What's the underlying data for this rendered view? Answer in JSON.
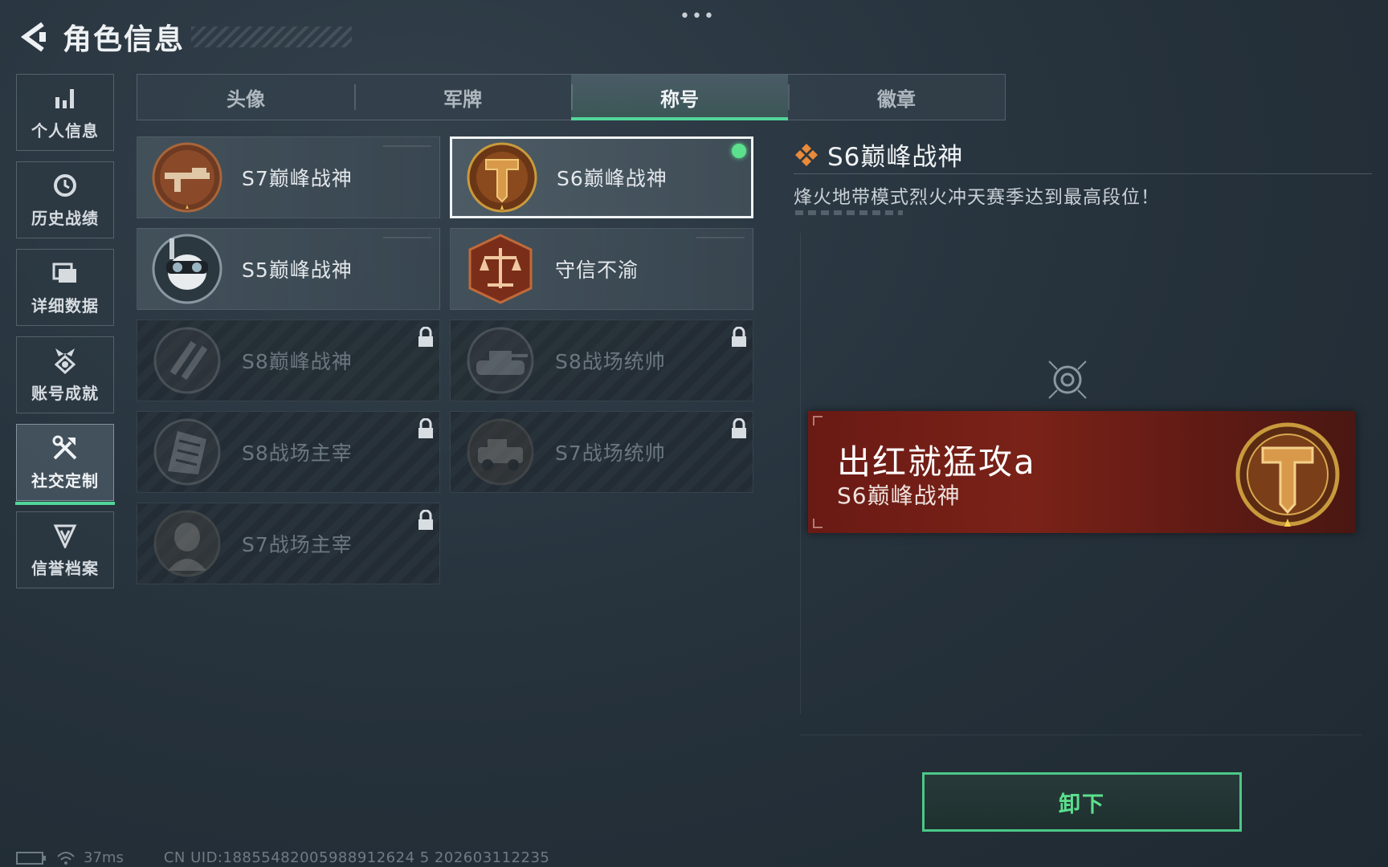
{
  "header": {
    "title": "角色信息",
    "back_icon": "back-arrow-icon",
    "more_icon": "more-dots-icon",
    "more_text": "•••"
  },
  "sidebar": {
    "items": [
      {
        "label": "个人信息",
        "icon": "bar-chart-icon",
        "active": false
      },
      {
        "label": "历史战绩",
        "icon": "clock-history-icon",
        "active": false
      },
      {
        "label": "详细数据",
        "icon": "folder-icon",
        "active": false
      },
      {
        "label": "账号成就",
        "icon": "medal-icon",
        "active": false
      },
      {
        "label": "社交定制",
        "icon": "tools-icon",
        "active": true
      },
      {
        "label": "信誉档案",
        "icon": "shield-badge-icon",
        "active": false
      }
    ]
  },
  "tabs": [
    {
      "label": "头像",
      "active": false
    },
    {
      "label": "军牌",
      "active": false
    },
    {
      "label": "称号",
      "active": true
    },
    {
      "label": "徽章",
      "active": false
    }
  ],
  "titles": [
    {
      "label": "S7巅峰战神",
      "locked": false,
      "selected": false,
      "emblem": "rifle-emblem-icon",
      "color": "#8a4a2a"
    },
    {
      "label": "S6巅峰战神",
      "locked": false,
      "selected": true,
      "emblem": "t-shield-emblem-icon",
      "color": "#8a4a1e"
    },
    {
      "label": "S5巅峰战神",
      "locked": false,
      "selected": false,
      "emblem": "skull-goggles-emblem-icon",
      "color": "#3a4650"
    },
    {
      "label": "守信不渝",
      "locked": false,
      "selected": false,
      "emblem": "scales-emblem-icon",
      "color": "#8e3a22"
    },
    {
      "label": "S8巅峰战神",
      "locked": true,
      "selected": false,
      "emblem": "slash-emblem-icon",
      "color": "#4a5660"
    },
    {
      "label": "S8战场统帅",
      "locked": true,
      "selected": false,
      "emblem": "tank-emblem-icon",
      "color": "#4a5660"
    },
    {
      "label": "S8战场主宰",
      "locked": true,
      "selected": false,
      "emblem": "building-emblem-icon",
      "color": "#4a5660"
    },
    {
      "label": "S7战场统帅",
      "locked": true,
      "selected": false,
      "emblem": "armored-car-emblem-icon",
      "color": "#5a4030"
    },
    {
      "label": "S7战场主宰",
      "locked": true,
      "selected": false,
      "emblem": "soldier-emblem-icon",
      "color": "#5a4838"
    }
  ],
  "detail": {
    "title": "S6巅峰战神",
    "description": "烽火地带模式烈火冲天赛季达到最高段位！",
    "title_icon": "diamond-cluster-icon",
    "target_icon": "target-reticle-icon"
  },
  "banner": {
    "player_name": "出红就猛攻a",
    "title": "S6巅峰战神",
    "emblem": "t-shield-emblem-icon"
  },
  "actions": {
    "unequip_label": "卸下"
  },
  "footer": {
    "ping": "37ms",
    "uid": "CN UID:18855482005988912624 5 202603112235"
  },
  "colors": {
    "accent": "#52d69a",
    "banner": "#7a2218",
    "equipped_dot": "#5ce08e"
  }
}
